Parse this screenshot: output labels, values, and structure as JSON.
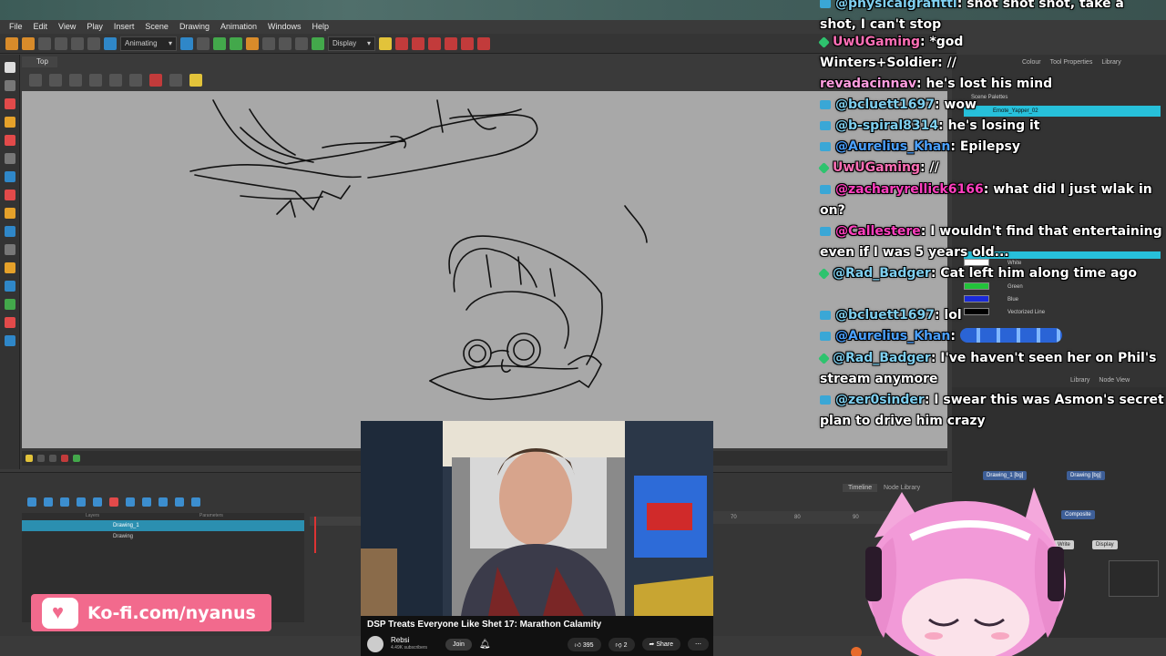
{
  "menu": [
    "File",
    "Edit",
    "View",
    "Play",
    "Insert",
    "Scene",
    "Drawing",
    "Animation",
    "Windows",
    "Help"
  ],
  "toolbar": {
    "mode": "Animating",
    "display": "Display"
  },
  "view_tab": "Top",
  "right_panel": {
    "tabs": [
      "Colour",
      "Tool Properties",
      "Library"
    ],
    "scene_palettes": "Scene Palettes",
    "palette": "Emote_Yapper_02",
    "swatches": [
      {
        "name": "White",
        "color": "#ffffff"
      },
      {
        "name": "Green",
        "color": "#22c33a"
      },
      {
        "name": "Blue",
        "color": "#1a2ad8"
      },
      {
        "name": "Vectorized Line",
        "color": "#000000"
      }
    ]
  },
  "node_view": {
    "tabs": [
      "Library",
      "Node View"
    ],
    "nodes": [
      "Drawing_1 [bg]",
      "Drawing [bg]",
      "Composite",
      "Write",
      "Display"
    ]
  },
  "timeline": {
    "tabs": [
      "Timeline",
      "Node Library"
    ],
    "layers_header": [
      "Layers",
      "Parameters"
    ],
    "layers": [
      {
        "name": "Drawing_1",
        "selected": true
      },
      {
        "name": "Drawing",
        "selected": false
      }
    ],
    "frames": [
      "70",
      "80",
      "90"
    ]
  },
  "chat": [
    {
      "user": "@physicalgrafitti",
      "text": "shot shot shot, take a shot, I can't stop",
      "badge": "yt",
      "user_color": "#7fd0f0"
    },
    {
      "user": "UwUGaming",
      "text": "*god",
      "badge": "tw",
      "user_color": "#ff6fb6"
    },
    {
      "user": "Winters+Soldier",
      "text": "//",
      "badge": "kofi",
      "user_color": "#ffffff"
    },
    {
      "user": "revadacinnav",
      "text": "he's lost his mind",
      "badge": "kofi",
      "user_color": "#ff9ee0"
    },
    {
      "user": "@bcluett1697",
      "text": "wow",
      "badge": "yt",
      "user_color": "#7fd0f0"
    },
    {
      "user": "@b-spiral8314",
      "text": "he's losing it",
      "badge": "yt",
      "user_color": "#7fd0f0"
    },
    {
      "user": "@Aurelius_Khan",
      "text": "Epilepsy",
      "badge": "yt",
      "user_color": "#4aa0ff"
    },
    {
      "user": "UwUGaming",
      "text": "//",
      "badge": "tw",
      "user_color": "#ff6fb6"
    },
    {
      "user": "@zacharyrellick6166",
      "text": "what did I just wlak in on?",
      "badge": "yt",
      "user_color": "#ff3fbf"
    },
    {
      "user": "@Callestere",
      "text": "I wouldn't find that entertaining even if I was 5 years old...",
      "badge": "yt",
      "user_color": "#ff3fbf"
    },
    {
      "user": "@Rad_Badger",
      "text": "Cat left him along time ago",
      "badge": "tw",
      "user_color": "#7fd0f0"
    },
    {
      "user": "@bcluett1697",
      "text": "lol",
      "badge": "yt",
      "user_color": "#7fd0f0"
    },
    {
      "user": "@Aurelius_Khan",
      "text": "",
      "badge": "yt",
      "user_color": "#4aa0ff"
    },
    {
      "user": "@Rad_Badger",
      "text": "I've haven't seen her on Phil's stream anymore",
      "badge": "tw",
      "user_color": "#7fd0f0"
    },
    {
      "user": "@zer0sinder",
      "text": "I swear this was Asmon's secret plan to drive him crazy",
      "badge": "yt",
      "user_color": "#7fd0f0"
    }
  ],
  "video": {
    "title": "DSP Treats Everyone Like Shet 17: Marathon Calamity",
    "channel": "Rebsi",
    "subs": "4.49K subscribers",
    "join": "Join",
    "likes": "395",
    "dislikes": "2",
    "share": "Share"
  },
  "kofi": {
    "text": "Ko-fi.com/nyanus"
  }
}
